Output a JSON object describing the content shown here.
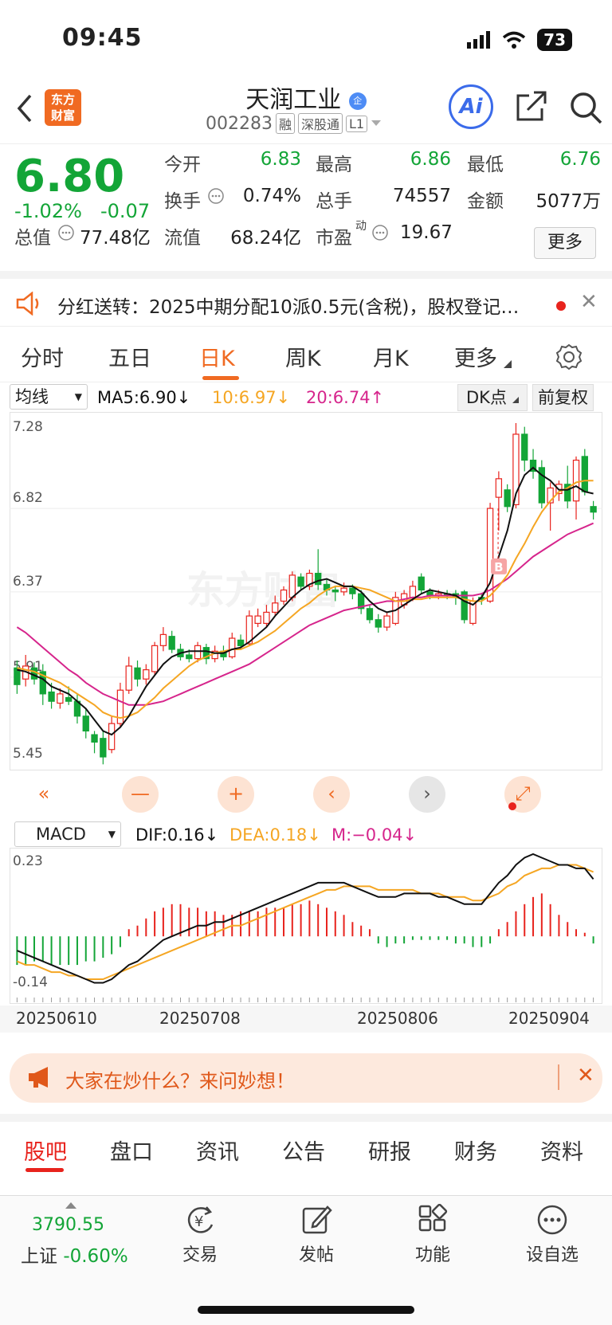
{
  "status": {
    "time": "09:45",
    "battery": "73"
  },
  "nav": {
    "logo_line1": "东方",
    "logo_line2": "财富",
    "stock_name": "天润工业",
    "name_badge": "企",
    "stock_code": "002283",
    "tags": [
      "融",
      "深股通",
      "L1"
    ],
    "ai_label": "Ai"
  },
  "quote": {
    "price": "6.80",
    "change_pct": "-1.02%",
    "change": "-0.07",
    "open_label": "今开",
    "open": "6.83",
    "high_label": "最高",
    "high": "6.86",
    "low_label": "最低",
    "low": "6.76",
    "turnover_label": "换手",
    "turnover": "0.74%",
    "volume_label": "总手",
    "volume": "74557",
    "amount_label": "金额",
    "amount": "5077万",
    "mktcap_label": "总值",
    "mktcap": "77.48亿",
    "float_label": "流值",
    "float": "68.24亿",
    "pe_label": "市盈",
    "pe_sup": "动",
    "pe": "19.67",
    "more": "更多"
  },
  "notice": {
    "text": "分红送转：2025中期分配10派0.5元(含税)，股权登记日…"
  },
  "tabs": [
    "分时",
    "五日",
    "日K",
    "周K",
    "月K",
    "更多"
  ],
  "ma": {
    "select": "均线",
    "ma5": "MA5:6.90↓",
    "ma10": "10:6.97↓",
    "ma20": "20:6.74↑",
    "dk": "DK点",
    "fq": "前复权",
    "colors": {
      "ma5": "#111111",
      "ma10": "#f5a623",
      "ma20": "#d6258c",
      "up": "#e8231d",
      "down": "#13a537"
    }
  },
  "chart_data": [
    {
      "type": "candlestick",
      "title": "",
      "y_ticks": [
        "7.28",
        "6.82",
        "6.37",
        "5.91",
        "5.45"
      ],
      "ylim": [
        5.45,
        7.28
      ],
      "x_ticks": [
        "20250610",
        "20250708",
        "20250806",
        "20250904"
      ],
      "marker": "B",
      "candles": [
        {
          "o": 5.96,
          "c": 5.87,
          "h": 6.0,
          "l": 5.82
        },
        {
          "o": 5.9,
          "c": 5.97,
          "h": 6.03,
          "l": 5.86
        },
        {
          "o": 5.96,
          "c": 5.9,
          "h": 5.99,
          "l": 5.87
        },
        {
          "o": 5.94,
          "c": 5.82,
          "h": 5.98,
          "l": 5.76
        },
        {
          "o": 5.83,
          "c": 5.78,
          "h": 5.88,
          "l": 5.74
        },
        {
          "o": 5.77,
          "c": 5.82,
          "h": 5.85,
          "l": 5.74
        },
        {
          "o": 5.8,
          "c": 5.78,
          "h": 5.86,
          "l": 5.76
        },
        {
          "o": 5.78,
          "c": 5.7,
          "h": 5.82,
          "l": 5.66
        },
        {
          "o": 5.7,
          "c": 5.62,
          "h": 5.74,
          "l": 5.58
        },
        {
          "o": 5.6,
          "c": 5.56,
          "h": 5.62,
          "l": 5.5
        },
        {
          "o": 5.58,
          "c": 5.48,
          "h": 5.62,
          "l": 5.44
        },
        {
          "o": 5.52,
          "c": 5.66,
          "h": 5.7,
          "l": 5.5
        },
        {
          "o": 5.66,
          "c": 5.84,
          "h": 5.88,
          "l": 5.64
        },
        {
          "o": 5.84,
          "c": 5.97,
          "h": 6.02,
          "l": 5.82
        },
        {
          "o": 5.96,
          "c": 5.9,
          "h": 6.0,
          "l": 5.86
        },
        {
          "o": 5.9,
          "c": 5.95,
          "h": 5.98,
          "l": 5.87
        },
        {
          "o": 5.94,
          "c": 6.08,
          "h": 6.1,
          "l": 5.92
        },
        {
          "o": 6.08,
          "c": 6.14,
          "h": 6.18,
          "l": 6.05
        },
        {
          "o": 6.13,
          "c": 6.06,
          "h": 6.16,
          "l": 6.04
        },
        {
          "o": 6.06,
          "c": 6.02,
          "h": 6.09,
          "l": 6.0
        },
        {
          "o": 6.03,
          "c": 6.01,
          "h": 6.06,
          "l": 5.99
        },
        {
          "o": 6.01,
          "c": 6.08,
          "h": 6.1,
          "l": 5.99
        },
        {
          "o": 6.07,
          "c": 6.01,
          "h": 6.09,
          "l": 5.98
        },
        {
          "o": 6.01,
          "c": 6.05,
          "h": 6.08,
          "l": 5.99
        },
        {
          "o": 6.05,
          "c": 6.02,
          "h": 6.08,
          "l": 6.0
        },
        {
          "o": 6.02,
          "c": 6.12,
          "h": 6.15,
          "l": 6.01
        },
        {
          "o": 6.11,
          "c": 6.08,
          "h": 6.14,
          "l": 6.06
        },
        {
          "o": 6.09,
          "c": 6.24,
          "h": 6.27,
          "l": 6.08
        },
        {
          "o": 6.2,
          "c": 6.24,
          "h": 6.28,
          "l": 6.18
        },
        {
          "o": 6.2,
          "c": 6.26,
          "h": 6.3,
          "l": 6.18
        },
        {
          "o": 6.26,
          "c": 6.31,
          "h": 6.35,
          "l": 6.24
        },
        {
          "o": 6.32,
          "c": 6.38,
          "h": 6.4,
          "l": 6.3
        },
        {
          "o": 6.34,
          "c": 6.46,
          "h": 6.48,
          "l": 6.32
        },
        {
          "o": 6.45,
          "c": 6.4,
          "h": 6.47,
          "l": 6.38
        },
        {
          "o": 6.4,
          "c": 6.47,
          "h": 6.49,
          "l": 6.38
        },
        {
          "o": 6.47,
          "c": 6.41,
          "h": 6.6,
          "l": 6.38
        },
        {
          "o": 6.41,
          "c": 6.38,
          "h": 6.44,
          "l": 6.35
        },
        {
          "o": 6.38,
          "c": 6.37,
          "h": 6.4,
          "l": 6.32
        },
        {
          "o": 6.37,
          "c": 6.39,
          "h": 6.42,
          "l": 6.35
        },
        {
          "o": 6.39,
          "c": 6.36,
          "h": 6.41,
          "l": 6.33
        },
        {
          "o": 6.36,
          "c": 6.28,
          "h": 6.38,
          "l": 6.25
        },
        {
          "o": 6.28,
          "c": 6.22,
          "h": 6.3,
          "l": 6.2
        },
        {
          "o": 6.22,
          "c": 6.18,
          "h": 6.25,
          "l": 6.15
        },
        {
          "o": 6.18,
          "c": 6.24,
          "h": 6.26,
          "l": 6.16
        },
        {
          "o": 6.2,
          "c": 6.34,
          "h": 6.37,
          "l": 6.19
        },
        {
          "o": 6.3,
          "c": 6.36,
          "h": 6.38,
          "l": 6.28
        },
        {
          "o": 6.34,
          "c": 6.4,
          "h": 6.43,
          "l": 6.32
        },
        {
          "o": 6.45,
          "c": 6.38,
          "h": 6.47,
          "l": 6.36
        },
        {
          "o": 6.37,
          "c": 6.35,
          "h": 6.39,
          "l": 6.33
        },
        {
          "o": 6.35,
          "c": 6.36,
          "h": 6.38,
          "l": 6.33
        },
        {
          "o": 6.36,
          "c": 6.35,
          "h": 6.38,
          "l": 6.33
        },
        {
          "o": 6.36,
          "c": 6.34,
          "h": 6.38,
          "l": 6.3
        },
        {
          "o": 6.37,
          "c": 6.22,
          "h": 6.38,
          "l": 6.2
        },
        {
          "o": 6.2,
          "c": 6.32,
          "h": 6.34,
          "l": 6.19
        },
        {
          "o": 6.34,
          "c": 6.33,
          "h": 6.36,
          "l": 6.3
        },
        {
          "o": 6.32,
          "c": 6.82,
          "h": 6.85,
          "l": 6.31
        },
        {
          "o": 6.88,
          "c": 6.98,
          "h": 7.02,
          "l": 6.7
        },
        {
          "o": 6.92,
          "c": 6.83,
          "h": 6.95,
          "l": 6.8
        },
        {
          "o": 6.84,
          "c": 7.22,
          "h": 7.28,
          "l": 6.82
        },
        {
          "o": 7.22,
          "c": 7.08,
          "h": 7.26,
          "l": 7.02
        },
        {
          "o": 7.08,
          "c": 7.02,
          "h": 7.14,
          "l": 6.98
        },
        {
          "o": 7.04,
          "c": 6.85,
          "h": 7.08,
          "l": 6.82
        },
        {
          "o": 6.85,
          "c": 6.93,
          "h": 6.96,
          "l": 6.7
        },
        {
          "o": 6.9,
          "c": 6.95,
          "h": 6.97,
          "l": 6.86
        },
        {
          "o": 6.95,
          "c": 6.86,
          "h": 7.05,
          "l": 6.82
        },
        {
          "o": 6.86,
          "c": 7.08,
          "h": 7.1,
          "l": 6.76
        },
        {
          "o": 7.1,
          "c": 6.91,
          "h": 7.14,
          "l": 6.89
        },
        {
          "o": 6.83,
          "c": 6.8,
          "h": 6.86,
          "l": 6.76
        }
      ],
      "ma5": [
        5.95,
        5.94,
        5.92,
        5.9,
        5.86,
        5.84,
        5.82,
        5.78,
        5.74,
        5.68,
        5.62,
        5.6,
        5.64,
        5.7,
        5.78,
        5.86,
        5.92,
        5.98,
        6.02,
        6.04,
        6.05,
        6.05,
        6.05,
        6.04,
        6.04,
        6.06,
        6.07,
        6.1,
        6.14,
        6.18,
        6.24,
        6.29,
        6.34,
        6.38,
        6.41,
        6.43,
        6.44,
        6.42,
        6.4,
        6.4,
        6.37,
        6.32,
        6.28,
        6.26,
        6.27,
        6.3,
        6.33,
        6.36,
        6.38,
        6.37,
        6.36,
        6.35,
        6.32,
        6.3,
        6.34,
        6.42,
        6.56,
        6.7,
        6.9,
        7.0,
        7.04,
        7.0,
        6.97,
        6.92,
        6.92,
        6.94,
        6.91,
        6.9
      ],
      "ma10": [
        5.96,
        5.95,
        5.94,
        5.92,
        5.9,
        5.88,
        5.85,
        5.82,
        5.79,
        5.76,
        5.72,
        5.7,
        5.69,
        5.7,
        5.72,
        5.76,
        5.8,
        5.85,
        5.89,
        5.93,
        5.97,
        6.0,
        6.02,
        6.04,
        6.05,
        6.06,
        6.06,
        6.08,
        6.1,
        6.13,
        6.16,
        6.2,
        6.24,
        6.28,
        6.31,
        6.35,
        6.38,
        6.4,
        6.4,
        6.4,
        6.39,
        6.38,
        6.36,
        6.34,
        6.32,
        6.32,
        6.33,
        6.33,
        6.34,
        6.34,
        6.34,
        6.34,
        6.33,
        6.32,
        6.32,
        6.35,
        6.4,
        6.46,
        6.55,
        6.63,
        6.72,
        6.8,
        6.86,
        6.91,
        6.93,
        6.96,
        6.97,
        6.97
      ],
      "ma20": [
        6.18,
        6.15,
        6.11,
        6.07,
        6.03,
        5.99,
        5.95,
        5.92,
        5.88,
        5.85,
        5.82,
        5.8,
        5.78,
        5.76,
        5.76,
        5.76,
        5.77,
        5.78,
        5.8,
        5.82,
        5.84,
        5.86,
        5.88,
        5.9,
        5.92,
        5.94,
        5.96,
        5.98,
        6.01,
        6.04,
        6.07,
        6.1,
        6.13,
        6.16,
        6.19,
        6.21,
        6.23,
        6.25,
        6.27,
        6.28,
        6.29,
        6.3,
        6.31,
        6.32,
        6.32,
        6.33,
        6.34,
        6.34,
        6.35,
        6.35,
        6.35,
        6.35,
        6.35,
        6.35,
        6.36,
        6.38,
        6.41,
        6.44,
        6.48,
        6.52,
        6.56,
        6.59,
        6.62,
        6.65,
        6.68,
        6.7,
        6.72,
        6.74
      ]
    },
    {
      "type": "bar",
      "title": "MACD",
      "y_ticks": [
        "0.23",
        "-0.14"
      ],
      "ylim": [
        -0.14,
        0.23
      ],
      "histogram": [
        -0.08,
        -0.08,
        -0.07,
        -0.07,
        -0.08,
        -0.08,
        -0.08,
        -0.08,
        -0.07,
        -0.07,
        -0.06,
        -0.05,
        -0.03,
        0.02,
        0.03,
        0.05,
        0.07,
        0.08,
        0.09,
        0.09,
        0.08,
        0.08,
        0.07,
        0.07,
        0.06,
        0.06,
        0.07,
        0.07,
        0.07,
        0.08,
        0.08,
        0.08,
        0.09,
        0.09,
        0.1,
        0.09,
        0.08,
        0.07,
        0.06,
        0.04,
        0.03,
        0.02,
        -0.02,
        -0.03,
        -0.02,
        -0.02,
        -0.01,
        -0.01,
        -0.01,
        -0.01,
        -0.01,
        -0.02,
        -0.02,
        -0.03,
        -0.03,
        -0.02,
        0.02,
        0.04,
        0.07,
        0.09,
        0.11,
        0.12,
        0.09,
        0.06,
        0.04,
        0.02,
        0.01,
        -0.02
      ],
      "dif": [
        -0.04,
        -0.05,
        -0.06,
        -0.07,
        -0.08,
        -0.09,
        -0.1,
        -0.11,
        -0.12,
        -0.13,
        -0.13,
        -0.12,
        -0.1,
        -0.08,
        -0.07,
        -0.05,
        -0.03,
        -0.01,
        0.0,
        0.01,
        0.02,
        0.03,
        0.03,
        0.04,
        0.04,
        0.05,
        0.06,
        0.07,
        0.08,
        0.09,
        0.1,
        0.11,
        0.12,
        0.13,
        0.14,
        0.15,
        0.15,
        0.15,
        0.15,
        0.14,
        0.13,
        0.12,
        0.11,
        0.11,
        0.11,
        0.12,
        0.12,
        0.12,
        0.12,
        0.11,
        0.11,
        0.1,
        0.09,
        0.09,
        0.09,
        0.12,
        0.15,
        0.17,
        0.2,
        0.22,
        0.23,
        0.22,
        0.21,
        0.2,
        0.2,
        0.19,
        0.19,
        0.16
      ],
      "dea": [
        -0.07,
        -0.08,
        -0.08,
        -0.09,
        -0.1,
        -0.1,
        -0.11,
        -0.11,
        -0.12,
        -0.12,
        -0.12,
        -0.11,
        -0.1,
        -0.09,
        -0.08,
        -0.07,
        -0.06,
        -0.05,
        -0.04,
        -0.03,
        -0.02,
        -0.01,
        0.0,
        0.01,
        0.02,
        0.03,
        0.03,
        0.04,
        0.05,
        0.06,
        0.07,
        0.08,
        0.09,
        0.1,
        0.11,
        0.12,
        0.13,
        0.13,
        0.14,
        0.14,
        0.14,
        0.14,
        0.13,
        0.13,
        0.13,
        0.13,
        0.13,
        0.12,
        0.12,
        0.12,
        0.11,
        0.11,
        0.11,
        0.1,
        0.1,
        0.11,
        0.12,
        0.14,
        0.15,
        0.17,
        0.18,
        0.19,
        0.19,
        0.2,
        0.2,
        0.2,
        0.19,
        0.18
      ]
    }
  ],
  "macd_row": {
    "select": "MACD",
    "dif": "DIF:0.16↓",
    "dea": "DEA:0.18↓",
    "m": "M:−0.04↓"
  },
  "ask": {
    "text": "大家在炒什么？来问妙想！"
  },
  "bottom_tabs": [
    "股吧",
    "盘口",
    "资讯",
    "公告",
    "研报",
    "财务",
    "资料"
  ],
  "dock": {
    "index_value": "3790.55",
    "index_name": "上证",
    "index_pct": "-0.60%",
    "items": [
      "交易",
      "发帖",
      "功能",
      "设自选"
    ]
  }
}
